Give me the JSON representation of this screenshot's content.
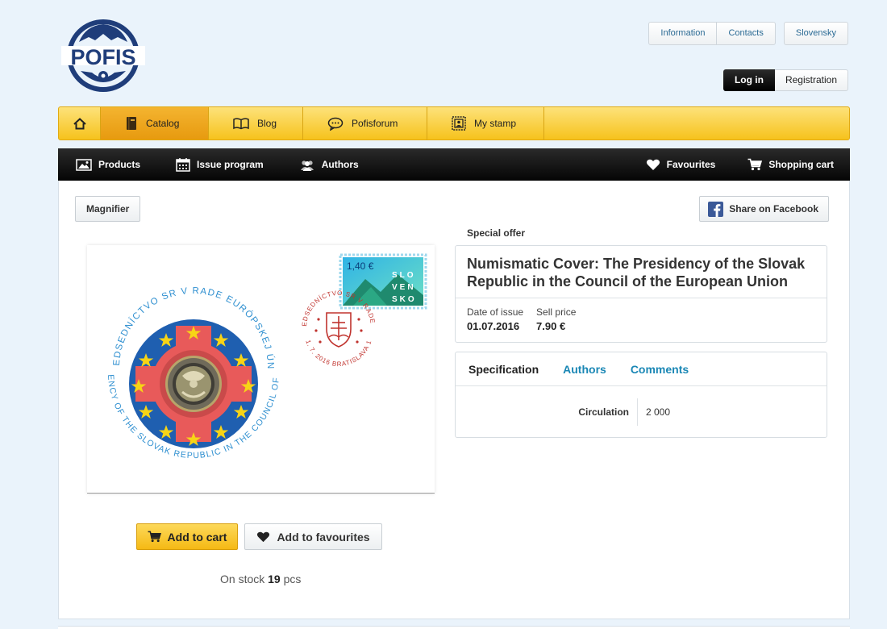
{
  "brand": {
    "logo_text": "POFIS"
  },
  "top_links": [
    "Information",
    "Contacts"
  ],
  "language": "Slovensky",
  "auth": {
    "login": "Log in",
    "register": "Registration"
  },
  "main_nav": [
    {
      "label": "Catalog",
      "icon": "book-icon",
      "active": true
    },
    {
      "label": "Blog",
      "icon": "open-book-icon",
      "active": false
    },
    {
      "label": "Pofisforum",
      "icon": "speech-bubble-icon",
      "active": false
    },
    {
      "label": "My stamp",
      "icon": "stamp-icon",
      "active": false
    }
  ],
  "sub_nav": {
    "left": [
      {
        "label": "Products",
        "icon": "image-icon"
      },
      {
        "label": "Issue program",
        "icon": "calendar-icon"
      },
      {
        "label": "Authors",
        "icon": "people-icon"
      }
    ],
    "right": [
      {
        "label": "Favourites",
        "icon": "heart-icon"
      },
      {
        "label": "Shopping cart",
        "icon": "cart-icon"
      }
    ]
  },
  "product": {
    "magnifier_label": "Magnifier",
    "share_label": "Share on Facebook",
    "badge": "Special offer",
    "title": "Numismatic Cover: The Presidency of the Slovak Republic in the Council of the European Union",
    "date_label": "Date of issue",
    "date_value": "01.07.2016",
    "price_label": "Sell price",
    "price_value": "7.90 €",
    "tabs": [
      "Specification",
      "Authors",
      "Comments"
    ],
    "spec": {
      "key": "Circulation",
      "value": "2 000"
    },
    "add_to_cart": "Add to cart",
    "add_to_favourites": "Add to favourites",
    "stock_prefix": "On stock",
    "stock_count": "19",
    "stock_suffix": "pcs"
  },
  "image": {
    "ring_top": "PREDSEDNÍCTVO SR V RADE EURÓPSKEJ ÚNIE",
    "ring_bottom": "PRESIDENCY OF THE SLOVAK REPUBLIC IN THE COUNCIL OF THE EU",
    "stamp_value": "1,40 €",
    "stamp_letters": [
      "SLO",
      "VEN",
      "SKO"
    ],
    "postmark_top": "PREDSEDNÍCTVO SR V RADE EÚ",
    "postmark_bottom": "1. 7. 2016 BRATISLAVA 1"
  },
  "colors": {
    "accent_yellow": "#f6c21c",
    "link_blue": "#1a87b5",
    "eu_blue": "#1f5fb0"
  }
}
